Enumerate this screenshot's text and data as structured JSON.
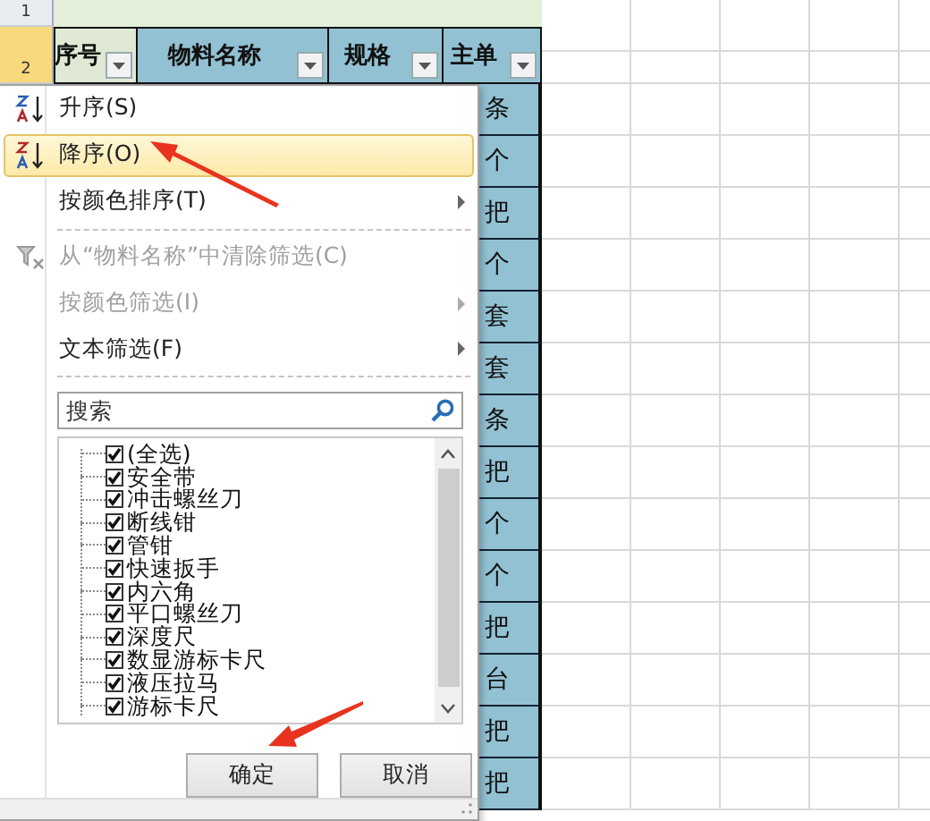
{
  "sheet": {
    "row_numbers": [
      "1",
      "2"
    ],
    "columns": [
      {
        "label": "序号"
      },
      {
        "label": "物料名称"
      },
      {
        "label": "规格"
      },
      {
        "label": "主单"
      }
    ],
    "units": [
      "条",
      "个",
      "把",
      "个",
      "套",
      "套",
      "条",
      "把",
      "个",
      "个",
      "把",
      "台",
      "把",
      "把"
    ]
  },
  "menu": {
    "items": [
      {
        "kind": "ascending",
        "label": "升序(S)",
        "highlighted": false,
        "disabled": false,
        "submenu": false
      },
      {
        "kind": "descending",
        "label": "降序(O)",
        "highlighted": true,
        "disabled": false,
        "submenu": false
      },
      {
        "kind": "item",
        "label": "按颜色排序(T)",
        "highlighted": false,
        "disabled": false,
        "submenu": true
      },
      {
        "kind": "separator"
      },
      {
        "kind": "clear",
        "label": "从“物料名称”中清除筛选(C)",
        "highlighted": false,
        "disabled": true,
        "submenu": false
      },
      {
        "kind": "item",
        "label": "按颜色筛选(I)",
        "highlighted": false,
        "disabled": true,
        "submenu": true
      },
      {
        "kind": "item",
        "label": "文本筛选(F)",
        "highlighted": false,
        "disabled": false,
        "submenu": true
      }
    ],
    "search": {
      "placeholder": "搜索"
    },
    "values": [
      {
        "label": "(全选)",
        "checked": true
      },
      {
        "label": "安全带",
        "checked": true
      },
      {
        "label": "冲击螺丝刀",
        "checked": true
      },
      {
        "label": "断线钳",
        "checked": true
      },
      {
        "label": "管钳",
        "checked": true
      },
      {
        "label": "快速扳手",
        "checked": true
      },
      {
        "label": "内六角",
        "checked": true
      },
      {
        "label": "平口螺丝刀",
        "checked": true
      },
      {
        "label": "深度尺",
        "checked": true
      },
      {
        "label": "数显游标卡尺",
        "checked": true
      },
      {
        "label": "液压拉马",
        "checked": true
      },
      {
        "label": "游标卡尺",
        "checked": true
      }
    ],
    "buttons": [
      "确定",
      "取消"
    ]
  }
}
